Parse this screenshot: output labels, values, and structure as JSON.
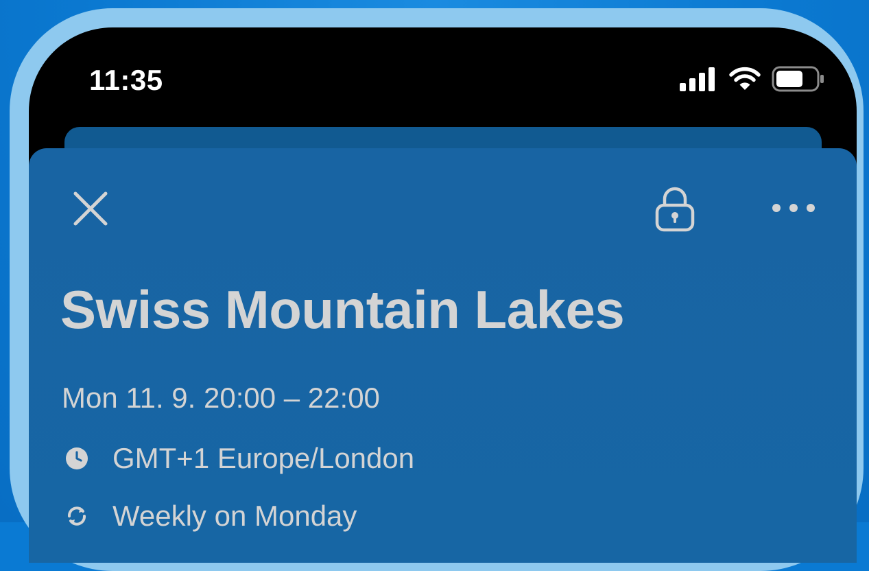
{
  "status_bar": {
    "time": "11:35",
    "signal_icon": "cellular-signal-icon",
    "wifi_icon": "wifi-icon",
    "battery_icon": "battery-icon"
  },
  "toolbar": {
    "close_icon": "close-icon",
    "lock_icon": "lock-icon",
    "more_icon": "more-options-icon"
  },
  "event": {
    "title": "Swiss Mountain Lakes",
    "datetime": "Mon 11. 9. 20:00 – 22:00",
    "timezone": "GMT+1 Europe/London",
    "timezone_icon": "clock-icon",
    "recurrence": "Weekly on Monday",
    "recurrence_icon": "repeat-icon"
  },
  "colors": {
    "background": "#0a7ad3",
    "frame": "#8ec9ef",
    "sheet": "#1864a3",
    "text": "#d4d4d4"
  }
}
